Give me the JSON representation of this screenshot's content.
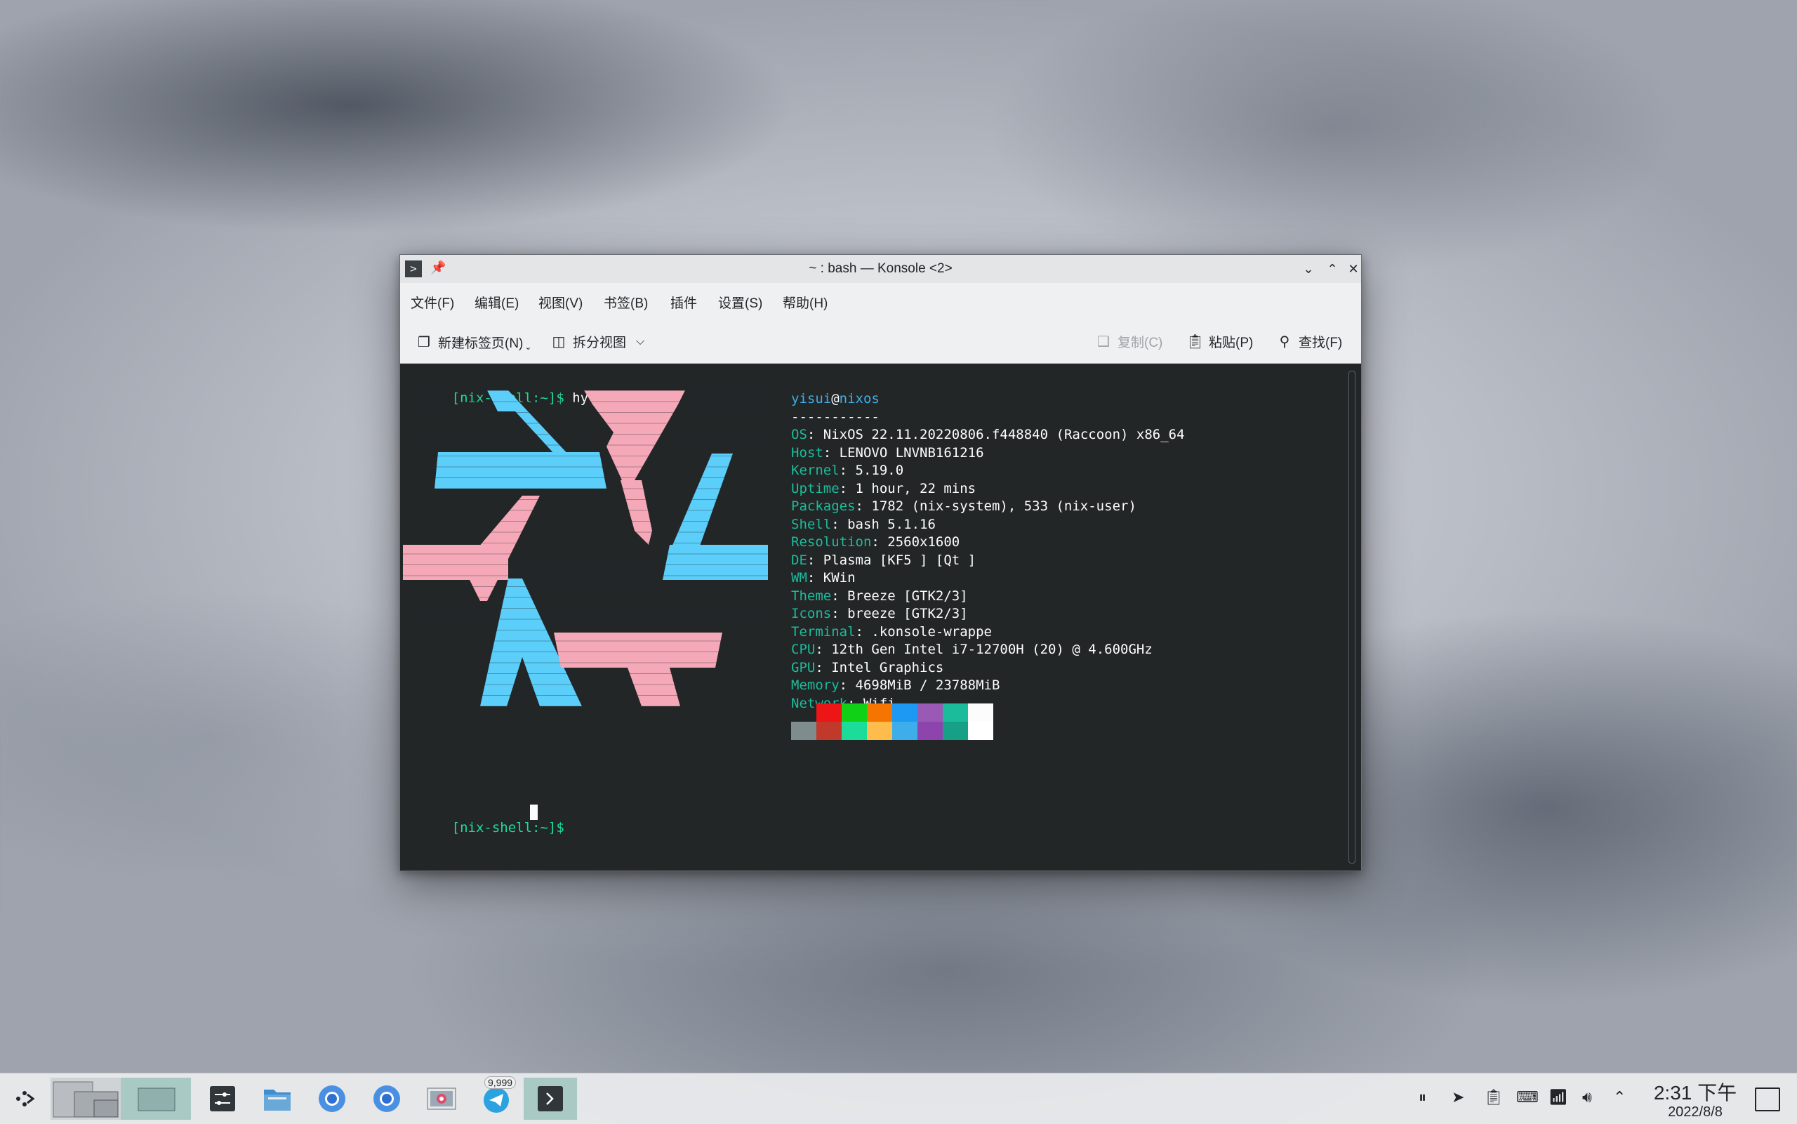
{
  "window": {
    "title": "~ : bash — Konsole <2>",
    "app_icon": ">",
    "controls": {
      "minimize": "⌄",
      "maximize": "⌃",
      "close": "✕"
    }
  },
  "menu": [
    "文件(F)",
    "编辑(E)",
    "视图(V)",
    "书签(B)",
    "插件",
    "设置(S)",
    "帮助(H)"
  ],
  "toolbar": {
    "new_tab": "新建标签页(N)",
    "split_view": "拆分视图",
    "copy": "复制(C)",
    "paste": "粘贴(P)",
    "find": "查找(F)"
  },
  "terminal": {
    "prompt": "[nix-shell:~]$",
    "command": " hyfetch",
    "user": "yisui",
    "at": "@",
    "host": "nixos",
    "separator": "-----------",
    "info": [
      {
        "key": "OS",
        "value": ": NixOS 22.11.20220806.f448840 (Raccoon) x86_64"
      },
      {
        "key": "Host",
        "value": ": LENOVO LNVNB161216"
      },
      {
        "key": "Kernel",
        "value": ": 5.19.0"
      },
      {
        "key": "Uptime",
        "value": ": 1 hour, 22 mins"
      },
      {
        "key": "Packages",
        "value": ": 1782 (nix-system), 533 (nix-user)"
      },
      {
        "key": "Shell",
        "value": ": bash 5.1.16"
      },
      {
        "key": "Resolution",
        "value": ": 2560x1600"
      },
      {
        "key": "DE",
        "value": ": Plasma [KF5 ] [Qt ]"
      },
      {
        "key": "WM",
        "value": ": KWin"
      },
      {
        "key": "Theme",
        "value": ": Breeze [GTK2/3]"
      },
      {
        "key": "Icons",
        "value": ": breeze [GTK2/3]"
      },
      {
        "key": "Terminal",
        "value": ": .konsole-wrappe"
      },
      {
        "key": "CPU",
        "value": ": 12th Gen Intel i7-12700H (20) @ 4.600GHz"
      },
      {
        "key": "GPU",
        "value": ": Intel Graphics"
      },
      {
        "key": "Memory",
        "value": ": 4698MiB / 23788MiB"
      },
      {
        "key": "Network",
        "value": ": Wifi"
      }
    ],
    "palette_top": [
      "#232627",
      "#ed1515",
      "#11d116",
      "#f67400",
      "#1d99f3",
      "#9b59b6",
      "#1abc9c",
      "#fcfcfc"
    ],
    "palette_bottom": [
      "#7f8c8d",
      "#c0392b",
      "#1cdc9a",
      "#fdbc4b",
      "#3daee9",
      "#8e44ad",
      "#16a085",
      "#ffffff"
    ],
    "logo_colors": {
      "blue": "#5bcefa",
      "pink": "#f5a9b8"
    }
  },
  "taskbar": {
    "badge": "9,999",
    "time": "2:31 下午",
    "date": "2022/8/8"
  }
}
